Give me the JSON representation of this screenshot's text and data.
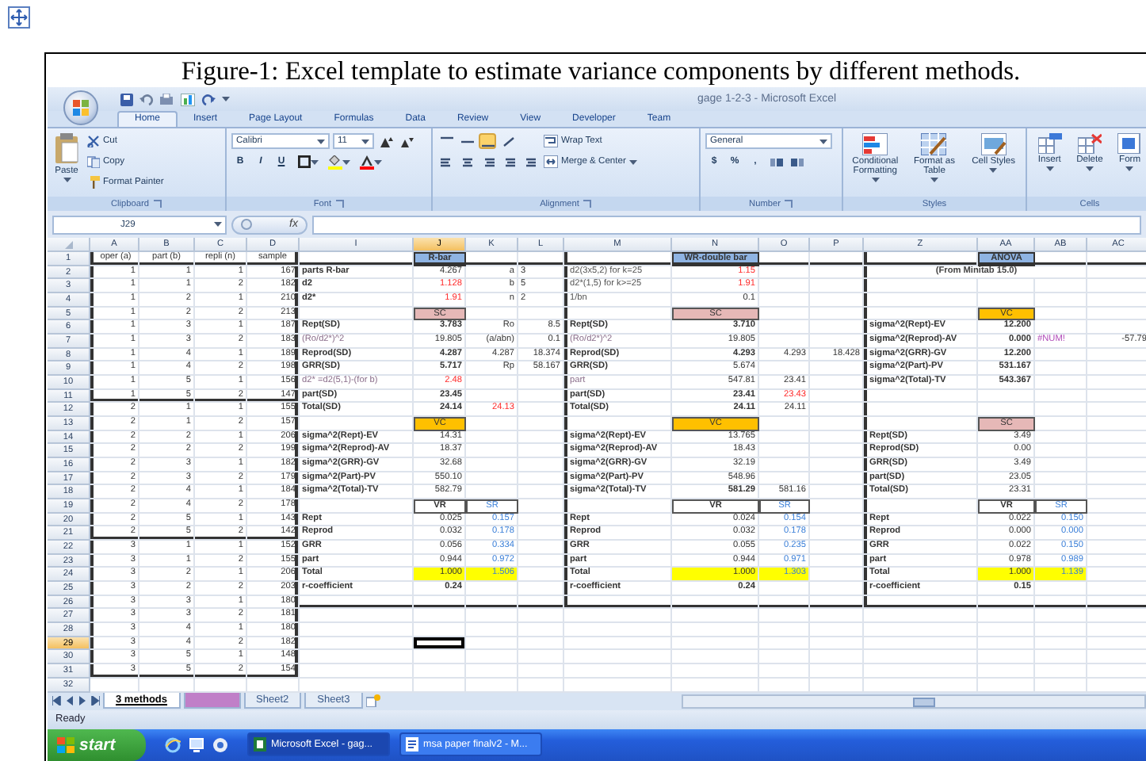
{
  "caption": "Figure-1: Excel template to estimate variance components by different methods.",
  "window": {
    "title": "gage 1-2-3 - Microsoft Excel"
  },
  "ribbon_tabs": [
    {
      "label": "Home",
      "selected": true
    },
    {
      "label": "Insert",
      "selected": false
    },
    {
      "label": "Page Layout",
      "selected": false
    },
    {
      "label": "Formulas",
      "selected": false
    },
    {
      "label": "Data",
      "selected": false
    },
    {
      "label": "Review",
      "selected": false
    },
    {
      "label": "View",
      "selected": false
    },
    {
      "label": "Developer",
      "selected": false
    },
    {
      "label": "Team",
      "selected": false
    }
  ],
  "ribbon": {
    "clipboard": {
      "label": "Clipboard",
      "paste": "Paste",
      "items": [
        "Cut",
        "Copy",
        "Format Painter"
      ]
    },
    "font": {
      "label": "Font",
      "font": "Calibri",
      "size": "11",
      "styles": [
        "B",
        "I",
        "U"
      ]
    },
    "alignment": {
      "label": "Alignment",
      "buttons": [
        {
          "selected": false
        },
        {
          "selected": false
        },
        {
          "selected": true
        },
        {
          "selected": false
        },
        {
          "selected": false
        },
        {
          "selected": false
        },
        {
          "selected": false
        },
        {
          "selected": false
        },
        {
          "selected": false
        }
      ],
      "wrap": "Wrap Text",
      "merge": "Merge & Center"
    },
    "number": {
      "label": "Number",
      "format": "General",
      "symbols": [
        "$",
        "%",
        ","
      ]
    },
    "styles": {
      "label": "Styles",
      "buttons": [
        "Conditional Formatting",
        "Format as Table",
        "Cell Styles"
      ]
    },
    "cells": {
      "label": "Cells",
      "buttons": [
        "Insert",
        "Delete",
        "Form"
      ]
    }
  },
  "formula_bar": {
    "name_box": "J29",
    "fx": "fx"
  },
  "sheet": {
    "columns": [
      {
        "label": "A",
        "selected": false
      },
      {
        "label": "B",
        "selected": false
      },
      {
        "label": "C",
        "selected": false
      },
      {
        "label": "D",
        "selected": false
      },
      {
        "label": "I",
        "selected": false
      },
      {
        "label": "J",
        "selected": true
      },
      {
        "label": "K",
        "selected": false
      },
      {
        "label": "L",
        "selected": false
      },
      {
        "label": "M",
        "selected": false
      },
      {
        "label": "N",
        "selected": false
      },
      {
        "label": "O",
        "selected": false
      },
      {
        "label": "P",
        "selected": false
      },
      {
        "label": "Z",
        "selected": false
      },
      {
        "label": "AA",
        "selected": false
      },
      {
        "label": "AB",
        "selected": false
      },
      {
        "label": "AC",
        "selected": false
      }
    ],
    "rows": [
      {
        "label": "1",
        "selected": false,
        "cells": [
          {
            "text": "oper (a)",
            "kind": "center"
          },
          {
            "text": "part (b)",
            "kind": "center"
          },
          {
            "text": "repli (n)",
            "kind": "center"
          },
          {
            "text": "sample",
            "kind": "center"
          },
          null,
          {
            "text": "R-bar",
            "kind": "head"
          },
          null,
          null,
          null,
          {
            "text": "WR-double bar",
            "kind": "head"
          },
          null,
          null,
          null,
          {
            "text": "ANOVA",
            "kind": "head"
          }
        ]
      },
      {
        "label": "2",
        "selected": false,
        "cells": [
          "1",
          "1",
          "1",
          "167",
          {
            "text": "parts R-bar",
            "kind": "label"
          },
          "4.267",
          "a",
          {
            "text": "3",
            "kind": "left"
          },
          {
            "text": "d2(3x5,2) for k=25",
            "kind": "text"
          },
          {
            "text": "1.15",
            "kind": "red"
          },
          null,
          null,
          {
            "text": "(From Minitab 15.0)",
            "kind": "wide"
          }
        ]
      },
      {
        "label": "3",
        "selected": false,
        "cells": [
          "1",
          "1",
          "2",
          "182",
          {
            "text": "d2",
            "kind": "label"
          },
          {
            "text": "1.128",
            "kind": "red"
          },
          "b",
          {
            "text": "5",
            "kind": "left"
          },
          {
            "text": "d2*(1,5) for k>=25",
            "kind": "text"
          },
          {
            "text": "1.91",
            "kind": "red"
          }
        ]
      },
      {
        "label": "4",
        "selected": false,
        "cells": [
          "1",
          "2",
          "1",
          "210",
          {
            "text": "d2*",
            "kind": "label"
          },
          {
            "text": "1.91",
            "kind": "red"
          },
          "n",
          {
            "text": "2",
            "kind": "left"
          },
          {
            "text": "1/bn",
            "kind": "text"
          },
          "0.1"
        ]
      },
      {
        "label": "5",
        "selected": false,
        "cells": [
          "1",
          "2",
          "2",
          "213",
          null,
          {
            "text": "SC",
            "kind": "sc"
          },
          null,
          null,
          null,
          {
            "text": "SC",
            "kind": "sc"
          },
          null,
          null,
          null,
          {
            "text": "VC",
            "kind": "vc"
          }
        ]
      },
      {
        "label": "6",
        "selected": false,
        "cells": [
          "1",
          "3",
          "1",
          "187",
          {
            "text": "Rept(SD)",
            "kind": "label"
          },
          {
            "text": "3.783",
            "kind": "bold"
          },
          "Ro",
          "8.5",
          {
            "text": "Rept(SD)",
            "kind": "label"
          },
          {
            "text": "3.710",
            "kind": "bold"
          },
          null,
          null,
          {
            "text": "sigma^2(Rept)-EV",
            "kind": "label"
          },
          {
            "text": "12.200",
            "kind": "bold"
          }
        ]
      },
      {
        "label": "7",
        "selected": false,
        "cells": [
          "1",
          "3",
          "2",
          "183",
          {
            "text": "(Ro/d2*)^2",
            "kind": "note"
          },
          "19.805",
          "(a/abn)",
          "0.1",
          {
            "text": "(Ro/d2*)^2",
            "kind": "note"
          },
          "19.805",
          null,
          null,
          {
            "text": "sigma^2(Reprod)-AV",
            "kind": "label"
          },
          {
            "text": "0.000",
            "kind": "bold"
          },
          {
            "text": "#NUM!",
            "kind": "purple"
          },
          "-57.79"
        ]
      },
      {
        "label": "8",
        "selected": false,
        "cells": [
          "1",
          "4",
          "1",
          "189",
          {
            "text": "Reprod(SD)",
            "kind": "label"
          },
          {
            "text": "4.287",
            "kind": "bold"
          },
          "4.287",
          "18.374",
          {
            "text": "Reprod(SD)",
            "kind": "label"
          },
          {
            "text": "4.293",
            "kind": "bold"
          },
          "4.293",
          "18.428",
          {
            "text": "sigma^2(GRR)-GV",
            "kind": "label"
          },
          {
            "text": "12.200",
            "kind": "bold"
          }
        ]
      },
      {
        "label": "9",
        "selected": false,
        "cells": [
          "1",
          "4",
          "2",
          "198",
          {
            "text": "GRR(SD)",
            "kind": "label"
          },
          {
            "text": "5.717",
            "kind": "bold"
          },
          "Rp",
          "58.167",
          {
            "text": "GRR(SD)",
            "kind": "label"
          },
          "5.674",
          null,
          null,
          {
            "text": "sigma^2(Part)-PV",
            "kind": "label"
          },
          {
            "text": "531.167",
            "kind": "bold"
          }
        ]
      },
      {
        "label": "10",
        "selected": false,
        "cells": [
          "1",
          "5",
          "1",
          "156",
          {
            "text": "d2* =d2(5,1)-(for b)",
            "kind": "note"
          },
          {
            "text": "2.48",
            "kind": "red"
          },
          null,
          null,
          {
            "text": "part",
            "kind": "note"
          },
          "547.81",
          "23.41",
          null,
          {
            "text": "sigma^2(Total)-TV",
            "kind": "label"
          },
          {
            "text": "543.367",
            "kind": "bold"
          }
        ]
      },
      {
        "label": "11",
        "selected": false,
        "cells": [
          "1",
          "5",
          "2",
          "147",
          {
            "text": "part(SD)",
            "kind": "label"
          },
          {
            "text": "23.45",
            "kind": "bold"
          },
          null,
          null,
          {
            "text": "part(SD)",
            "kind": "label"
          },
          {
            "text": "23.41",
            "kind": "bold"
          },
          {
            "text": "23.43",
            "kind": "red"
          }
        ]
      },
      {
        "label": "12",
        "selected": false,
        "cells": [
          "2",
          "1",
          "1",
          "155",
          {
            "text": "Total(SD)",
            "kind": "label"
          },
          {
            "text": "24.14",
            "kind": "bold"
          },
          {
            "text": "24.13",
            "kind": "red"
          },
          null,
          {
            "text": "Total(SD)",
            "kind": "label"
          },
          {
            "text": "24.11",
            "kind": "bold"
          },
          "24.11"
        ]
      },
      {
        "label": "13",
        "selected": false,
        "cells": [
          "2",
          "1",
          "2",
          "157",
          null,
          {
            "text": "VC",
            "kind": "vc"
          },
          null,
          null,
          null,
          {
            "text": "VC",
            "kind": "vc"
          },
          null,
          null,
          null,
          {
            "text": "SC",
            "kind": "sc"
          }
        ]
      },
      {
        "label": "14",
        "selected": false,
        "cells": [
          "2",
          "2",
          "1",
          "206",
          {
            "text": "sigma^2(Rept)-EV",
            "kind": "label"
          },
          "14.31",
          null,
          null,
          {
            "text": "sigma^2(Rept)-EV",
            "kind": "label"
          },
          "13.765",
          null,
          null,
          {
            "text": "Rept(SD)",
            "kind": "label"
          },
          "3.49"
        ]
      },
      {
        "label": "15",
        "selected": false,
        "cells": [
          "2",
          "2",
          "2",
          "199",
          {
            "text": "sigma^2(Reprod)-AV",
            "kind": "label"
          },
          "18.37",
          null,
          null,
          {
            "text": "sigma^2(Reprod)-AV",
            "kind": "label"
          },
          "18.43",
          null,
          null,
          {
            "text": "Reprod(SD)",
            "kind": "label"
          },
          "0.00"
        ]
      },
      {
        "label": "16",
        "selected": false,
        "cells": [
          "2",
          "3",
          "1",
          "182",
          {
            "text": "sigma^2(GRR)-GV",
            "kind": "label"
          },
          "32.68",
          null,
          null,
          {
            "text": "sigma^2(GRR)-GV",
            "kind": "label"
          },
          "32.19",
          null,
          null,
          {
            "text": "GRR(SD)",
            "kind": "label"
          },
          "3.49"
        ]
      },
      {
        "label": "17",
        "selected": false,
        "cells": [
          "2",
          "3",
          "2",
          "179",
          {
            "text": "sigma^2(Part)-PV",
            "kind": "label"
          },
          "550.10",
          null,
          null,
          {
            "text": "sigma^2(Part)-PV",
            "kind": "label"
          },
          "548.96",
          null,
          null,
          {
            "text": "part(SD)",
            "kind": "label"
          },
          "23.05"
        ]
      },
      {
        "label": "18",
        "selected": false,
        "cells": [
          "2",
          "4",
          "1",
          "184",
          {
            "text": "sigma^2(Total)-TV",
            "kind": "label"
          },
          "582.79",
          null,
          null,
          {
            "text": "sigma^2(Total)-TV",
            "kind": "label"
          },
          {
            "text": "581.29",
            "kind": "bold"
          },
          "581.16",
          null,
          {
            "text": "Total(SD)",
            "kind": "label"
          },
          "23.31"
        ]
      },
      {
        "label": "19",
        "selected": false,
        "cells": [
          "2",
          "4",
          "2",
          "178",
          null,
          {
            "text": "VR",
            "kind": "vr"
          },
          {
            "text": "SR",
            "kind": "sr"
          },
          null,
          null,
          {
            "text": "VR",
            "kind": "vr"
          },
          {
            "text": "SR",
            "kind": "sr"
          },
          null,
          null,
          {
            "text": "VR",
            "kind": "vr"
          },
          {
            "text": "SR",
            "kind": "sr"
          }
        ]
      },
      {
        "label": "20",
        "selected": false,
        "cells": [
          "2",
          "5",
          "1",
          "143",
          {
            "text": "Rept",
            "kind": "label"
          },
          "0.025",
          {
            "text": "0.157",
            "kind": "blue"
          },
          null,
          {
            "text": "Rept",
            "kind": "label"
          },
          "0.024",
          {
            "text": "0.154",
            "kind": "blue"
          },
          null,
          {
            "text": "Rept",
            "kind": "label"
          },
          "0.022",
          {
            "text": "0.150",
            "kind": "blue"
          }
        ]
      },
      {
        "label": "21",
        "selected": false,
        "cells": [
          "2",
          "5",
          "2",
          "142",
          {
            "text": "Reprod",
            "kind": "label"
          },
          "0.032",
          {
            "text": "0.178",
            "kind": "blue"
          },
          null,
          {
            "text": "Reprod",
            "kind": "label"
          },
          "0.032",
          {
            "text": "0.178",
            "kind": "blue"
          },
          null,
          {
            "text": "Reprod",
            "kind": "label"
          },
          "0.000",
          {
            "text": "0.000",
            "kind": "blue"
          }
        ]
      },
      {
        "label": "22",
        "selected": false,
        "cells": [
          "3",
          "1",
          "1",
          "152",
          {
            "text": "GRR",
            "kind": "label"
          },
          "0.056",
          {
            "text": "0.334",
            "kind": "blue"
          },
          null,
          {
            "text": "GRR",
            "kind": "label"
          },
          "0.055",
          {
            "text": "0.235",
            "kind": "blue"
          },
          null,
          {
            "text": "GRR",
            "kind": "label"
          },
          "0.022",
          {
            "text": "0.150",
            "kind": "blue"
          }
        ]
      },
      {
        "label": "23",
        "selected": false,
        "cells": [
          "3",
          "1",
          "2",
          "155",
          {
            "text": "part",
            "kind": "label"
          },
          "0.944",
          {
            "text": "0.972",
            "kind": "blue"
          },
          null,
          {
            "text": "part",
            "kind": "label"
          },
          "0.944",
          {
            "text": "0.971",
            "kind": "blue"
          },
          null,
          {
            "text": "part",
            "kind": "label"
          },
          "0.978",
          {
            "text": "0.989",
            "kind": "blue"
          }
        ]
      },
      {
        "label": "24",
        "selected": false,
        "cells": [
          "3",
          "2",
          "1",
          "206",
          {
            "text": "Total",
            "kind": "label"
          },
          {
            "text": "1.000",
            "kind": "total"
          },
          {
            "text": "1.506",
            "kind": "total-sr"
          },
          null,
          {
            "text": "Total",
            "kind": "label"
          },
          {
            "text": "1.000",
            "kind": "total"
          },
          {
            "text": "1.303",
            "kind": "total-sr"
          },
          null,
          {
            "text": "Total",
            "kind": "label"
          },
          {
            "text": "1.000",
            "kind": "total"
          },
          {
            "text": "1.139",
            "kind": "total-sr"
          }
        ]
      },
      {
        "label": "25",
        "selected": false,
        "cells": [
          "3",
          "2",
          "2",
          "203",
          {
            "text": "r-coefficient",
            "kind": "label"
          },
          {
            "text": "0.24",
            "kind": "bold"
          },
          null,
          null,
          {
            "text": "r-coefficient",
            "kind": "label"
          },
          {
            "text": "0.24",
            "kind": "bold"
          },
          null,
          null,
          {
            "text": "r-coefficient",
            "kind": "label"
          },
          {
            "text": "0.15",
            "kind": "bold"
          }
        ]
      },
      {
        "label": "26",
        "selected": false,
        "cells": [
          "3",
          "3",
          "1",
          "180"
        ]
      },
      {
        "label": "27",
        "selected": false,
        "cells": [
          "3",
          "3",
          "2",
          "181"
        ]
      },
      {
        "label": "28",
        "selected": false,
        "cells": [
          "3",
          "4",
          "1",
          "180"
        ]
      },
      {
        "label": "29",
        "selected": true,
        "cells": [
          "3",
          "4",
          "2",
          "182"
        ]
      },
      {
        "label": "30",
        "selected": false,
        "cells": [
          "3",
          "5",
          "1",
          "148"
        ]
      },
      {
        "label": "31",
        "selected": false,
        "cells": [
          "3",
          "5",
          "2",
          "154"
        ]
      },
      {
        "label": "32",
        "selected": false
      }
    ]
  },
  "sheet_tabs": [
    {
      "label": "3 methods",
      "selected": true
    },
    {
      "selected": false,
      "color": "#c07fc8"
    },
    {
      "label": "Sheet2",
      "selected": false
    },
    {
      "label": "Sheet3",
      "selected": false
    }
  ],
  "status_bar": {
    "text": "Ready"
  },
  "taskbar": {
    "start": "start",
    "tasks": [
      {
        "label": "Microsoft Excel - gag...",
        "selected": true
      },
      {
        "label": "msa paper finalv2 - M...",
        "selected": false
      }
    ]
  }
}
